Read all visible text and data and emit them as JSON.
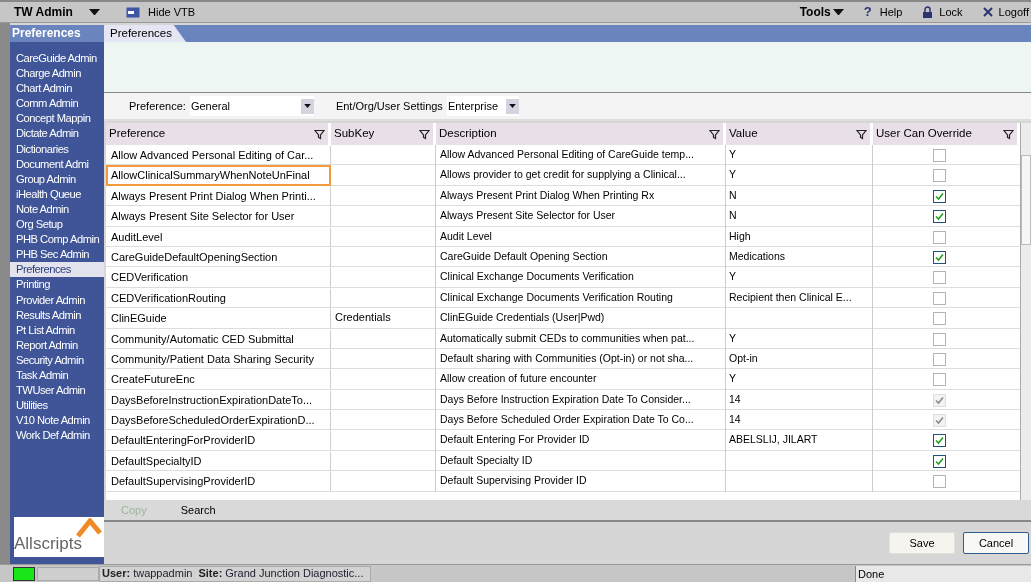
{
  "top_bar": {
    "app_menu": "TW Admin",
    "hide_button": "Hide VTB",
    "tools_menu": "Tools",
    "help": "Help",
    "lock": "Lock",
    "logoff": "Logoff",
    "help_icon": "?"
  },
  "sidebar": {
    "title": "Preferences",
    "items": [
      {
        "label": "CareGuide Admin",
        "selected": false
      },
      {
        "label": "Charge Admin",
        "selected": false
      },
      {
        "label": "Chart Admin",
        "selected": false
      },
      {
        "label": "Comm Admin",
        "selected": false
      },
      {
        "label": "Concept Mappin",
        "selected": false
      },
      {
        "label": "Dictate Admin",
        "selected": false
      },
      {
        "label": "Dictionaries",
        "selected": false
      },
      {
        "label": "Document Admi",
        "selected": false
      },
      {
        "label": "Group Admin",
        "selected": false
      },
      {
        "label": "iHealth Queue",
        "selected": false
      },
      {
        "label": "Note Admin",
        "selected": false
      },
      {
        "label": "Org Setup",
        "selected": false
      },
      {
        "label": "PHB Comp Admin",
        "selected": false
      },
      {
        "label": "PHB Sec Admin",
        "selected": false
      },
      {
        "label": "Preferences",
        "selected": true
      },
      {
        "label": "Printing",
        "selected": false
      },
      {
        "label": "Provider Admin",
        "selected": false
      },
      {
        "label": "Results Admin",
        "selected": false
      },
      {
        "label": "Pt List Admin",
        "selected": false
      },
      {
        "label": "Report Admin",
        "selected": false
      },
      {
        "label": "Security Admin",
        "selected": false
      },
      {
        "label": "Task Admin",
        "selected": false
      },
      {
        "label": "TWUser Admin",
        "selected": false
      },
      {
        "label": "Utilities",
        "selected": false
      },
      {
        "label": "V10 Note Admin",
        "selected": false
      },
      {
        "label": "Work Def Admin",
        "selected": false
      }
    ],
    "logo": "Allscripts"
  },
  "tabs": [
    {
      "label": "Preferences",
      "selected": true
    }
  ],
  "filters": [
    {
      "label": "Preference:",
      "value": "General"
    },
    {
      "label": "Ent/Org/User Settings",
      "value": "Enterprise"
    }
  ],
  "table": {
    "columns": [
      "Preference",
      "SubKey",
      "Description",
      "Value",
      "User Can Override"
    ],
    "rows": [
      {
        "preference": "Allow Advanced Personal Editing of Car...",
        "subkey": "",
        "description": "Allow Advanced Personal Editing of CareGuide temp...",
        "value": "Y",
        "override": {
          "checked": false,
          "disabled": false
        },
        "highlighted": false
      },
      {
        "preference": "AllowClinicalSummaryWhenNoteUnFinal",
        "subkey": "",
        "description": "Allows provider to get credit for supplying a Clinical...",
        "value": "Y",
        "override": {
          "checked": false,
          "disabled": false
        },
        "highlighted": true
      },
      {
        "preference": "Always Present Print Dialog When Printi...",
        "subkey": "",
        "description": "Always Present Print Dialog When Printing Rx",
        "value": "N",
        "override": {
          "checked": true,
          "disabled": false
        },
        "highlighted": false
      },
      {
        "preference": "Always Present Site Selector for User",
        "subkey": "",
        "description": "Always Present Site Selector for User",
        "value": "N",
        "override": {
          "checked": true,
          "disabled": false
        },
        "highlighted": false
      },
      {
        "preference": "AuditLevel",
        "subkey": "",
        "description": "Audit Level",
        "value": "High",
        "override": {
          "checked": false,
          "disabled": false
        },
        "highlighted": false
      },
      {
        "preference": "CareGuideDefaultOpeningSection",
        "subkey": "",
        "description": "CareGuide Default Opening Section",
        "value": "Medications",
        "override": {
          "checked": true,
          "disabled": false
        },
        "highlighted": false
      },
      {
        "preference": "CEDVerification",
        "subkey": "",
        "description": "Clinical Exchange Documents Verification",
        "value": "Y",
        "override": {
          "checked": false,
          "disabled": false
        },
        "highlighted": false
      },
      {
        "preference": "CEDVerificationRouting",
        "subkey": "",
        "description": "Clinical Exchange Documents Verification Routing",
        "value": "Recipient then Clinical E...",
        "override": {
          "checked": false,
          "disabled": false
        },
        "highlighted": false
      },
      {
        "preference": "ClinEGuide",
        "subkey": "Credentials",
        "description": "ClinEGuide Credentials (User|Pwd)",
        "value": "",
        "override": {
          "checked": false,
          "disabled": false
        },
        "highlighted": false
      },
      {
        "preference": "Community/Automatic CED Submittal",
        "subkey": "",
        "description": "Automatically submit CEDs to communities when pat...",
        "value": "Y",
        "override": {
          "checked": false,
          "disabled": false
        },
        "highlighted": false
      },
      {
        "preference": "Community/Patient Data Sharing Security",
        "subkey": "",
        "description": "Default sharing with Communities (Opt-in) or not sha...",
        "value": "Opt-in",
        "override": {
          "checked": false,
          "disabled": false
        },
        "highlighted": false
      },
      {
        "preference": "CreateFutureEnc",
        "subkey": "",
        "description": "Allow creation of future encounter",
        "value": "Y",
        "override": {
          "checked": false,
          "disabled": false
        },
        "highlighted": false
      },
      {
        "preference": "DaysBeforeInstructionExpirationDateTo...",
        "subkey": "",
        "description": "Days Before Instruction Expiration Date To Consider...",
        "value": "14",
        "override": {
          "checked": true,
          "disabled": true
        },
        "highlighted": false
      },
      {
        "preference": "DaysBeforeScheduledOrderExpirationD...",
        "subkey": "",
        "description": "Days Before Scheduled Order Expiration Date To Co...",
        "value": "14",
        "override": {
          "checked": true,
          "disabled": true
        },
        "highlighted": false
      },
      {
        "preference": "DefaultEnteringForProviderID",
        "subkey": "",
        "description": "Default Entering For Provider ID",
        "value": "ABELSLIJ, JILART",
        "override": {
          "checked": true,
          "disabled": false
        },
        "highlighted": false
      },
      {
        "preference": "DefaultSpecialtyID",
        "subkey": "",
        "description": "Default Specialty ID",
        "value": "",
        "override": {
          "checked": true,
          "disabled": false
        },
        "highlighted": false
      },
      {
        "preference": "DefaultSupervisingProviderID",
        "subkey": "",
        "description": "Default Supervising Provider ID",
        "value": "",
        "override": {
          "checked": false,
          "disabled": false
        },
        "highlighted": false
      }
    ]
  },
  "toolbar": [
    {
      "label": "Copy",
      "disabled": true
    },
    {
      "label": "Search",
      "disabled": false
    }
  ],
  "buttons": [
    {
      "label": "Save",
      "kind": "plain"
    },
    {
      "label": "Cancel",
      "kind": "default"
    }
  ],
  "status_bar": {
    "fields": [
      {
        "label": "User:",
        "value": "twappadmin"
      },
      {
        "label": "Site:",
        "value": "Grand Junction Diagnostic..."
      }
    ],
    "state": "Done"
  }
}
